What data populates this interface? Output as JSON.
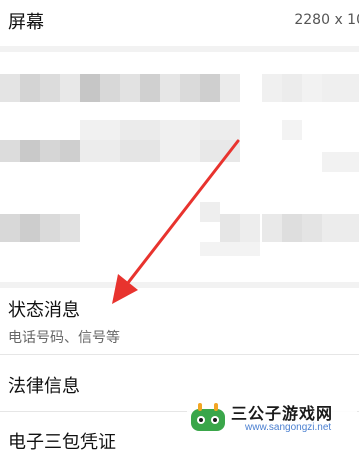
{
  "settings": {
    "screen": {
      "label": "屏幕",
      "value": "2280 x 10"
    },
    "status_info": {
      "title": "状态消息",
      "subtitle": "电话号码、信号等"
    },
    "legal_info": {
      "title": "法律信息"
    },
    "e_warranty": {
      "title": "电子三包凭证"
    }
  },
  "watermark": {
    "site_name": "三公子游戏网",
    "site_url": "www.sangongzi.net"
  },
  "colors": {
    "arrow": "#e8332e",
    "divider": "#e6e6e6",
    "section_gap": "#f2f2f2",
    "watermark_blue": "#4a7fd0"
  }
}
